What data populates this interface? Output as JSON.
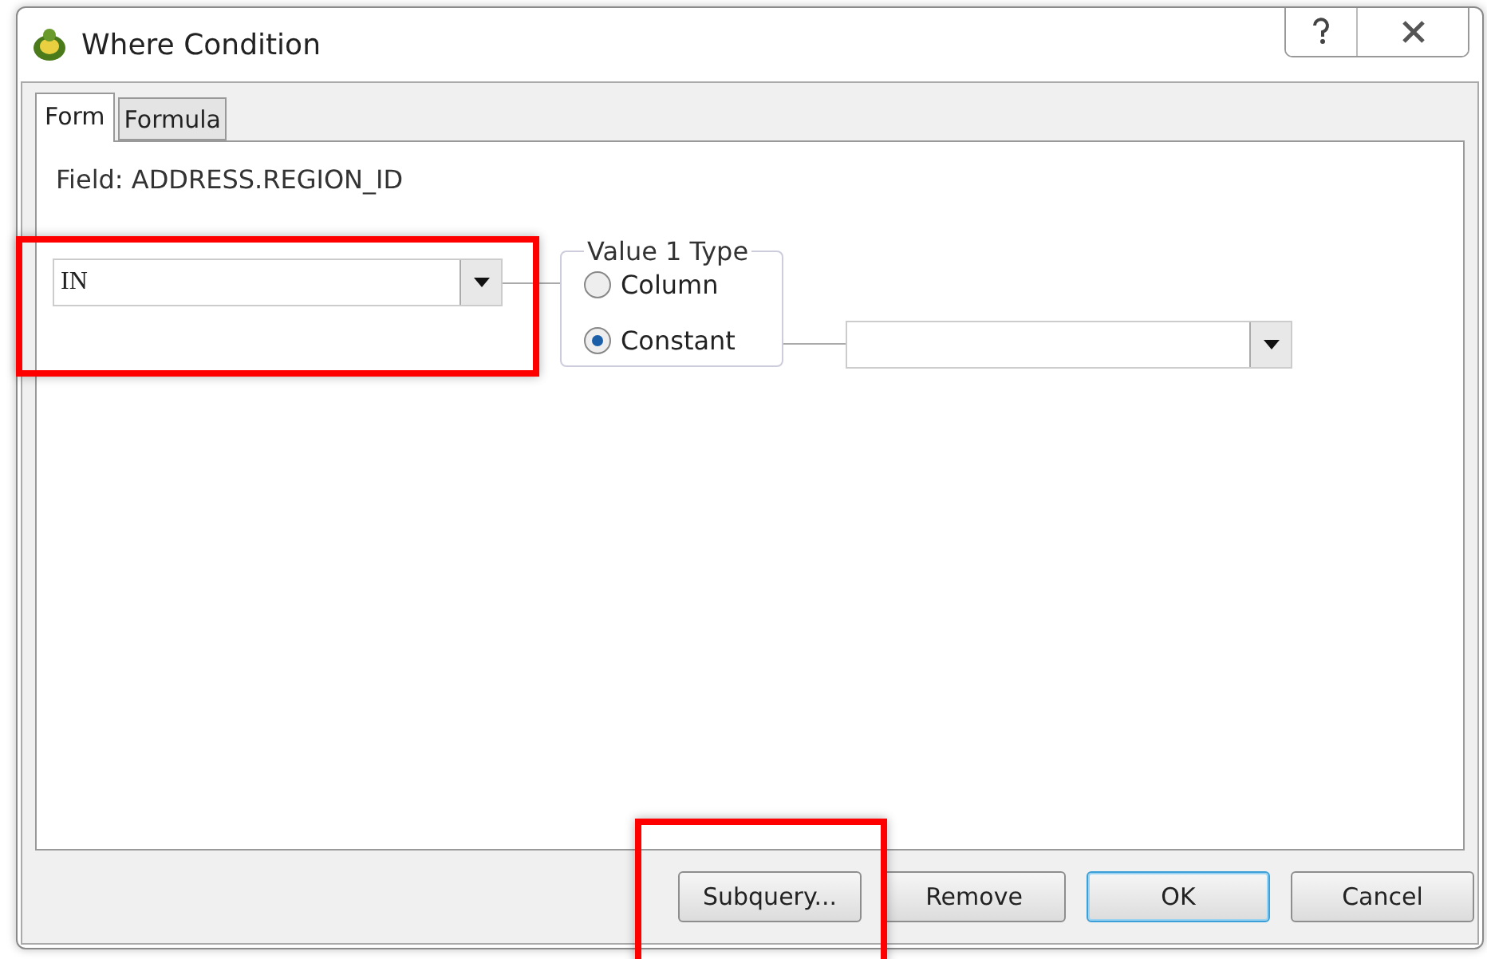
{
  "window": {
    "title": "Where Condition"
  },
  "tabs": [
    {
      "label": "Form",
      "selected": true
    },
    {
      "label": "Formula",
      "selected": false
    }
  ],
  "field_label": "Field: ADDRESS.REGION_ID",
  "operator": {
    "value": "IN"
  },
  "value_type": {
    "title": "Value 1 Type",
    "options": [
      {
        "label": "Column",
        "selected": false
      },
      {
        "label": "Constant",
        "selected": true
      }
    ]
  },
  "buttons": [
    {
      "label": "Subquery...",
      "default": false
    },
    {
      "label": "Remove",
      "default": false
    },
    {
      "label": "OK",
      "default": true
    },
    {
      "label": "Cancel",
      "default": false
    }
  ]
}
